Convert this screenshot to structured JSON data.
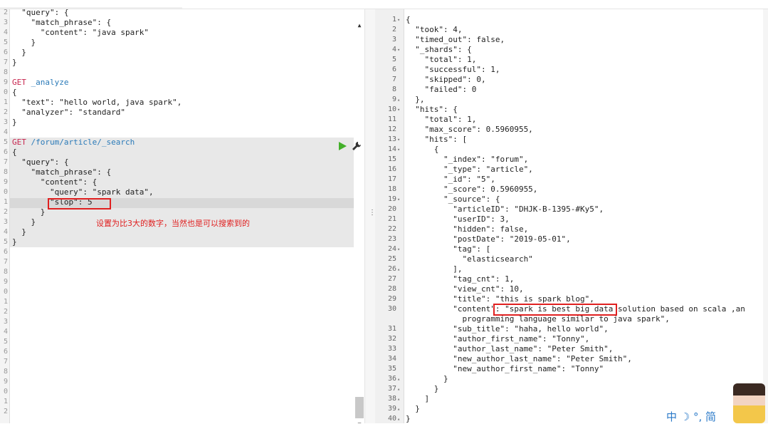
{
  "request": {
    "gutter_numbers": [
      "2",
      "3",
      "4",
      "5",
      "6",
      "7",
      "8",
      "9",
      "0",
      "1",
      "2",
      "3",
      "4",
      "5",
      "6",
      "7",
      "8",
      "9",
      "0",
      "1",
      "2",
      "3",
      "4",
      "5",
      "6",
      "7",
      "8",
      "9",
      "0",
      "1",
      "2",
      "3",
      "4",
      "5",
      "6",
      "7",
      "8",
      "9",
      "0",
      "1",
      "2"
    ],
    "lines": [
      {
        "indent": "  ",
        "text": "\"query\": {"
      },
      {
        "indent": "    ",
        "text": "\"match_phrase\": {"
      },
      {
        "indent": "      ",
        "text": "\"content\": \"java spark\""
      },
      {
        "indent": "    ",
        "text": "}"
      },
      {
        "indent": "  ",
        "text": "}"
      },
      {
        "indent": "",
        "text": "}"
      },
      {
        "indent": "",
        "text": ""
      },
      {
        "indent": "",
        "method": "GET",
        "url": "_analyze"
      },
      {
        "indent": "",
        "text": "{"
      },
      {
        "indent": "  ",
        "text": "\"text\": \"hello world, java spark\","
      },
      {
        "indent": "  ",
        "text": "\"analyzer\": \"standard\""
      },
      {
        "indent": "",
        "text": "}"
      },
      {
        "indent": "",
        "text": ""
      },
      {
        "indent": "",
        "method": "GET",
        "url": "/forum/article/_search"
      },
      {
        "indent": "",
        "text": "{"
      },
      {
        "indent": "  ",
        "text": "\"query\": {"
      },
      {
        "indent": "    ",
        "text": "\"match_phrase\": {"
      },
      {
        "indent": "      ",
        "text": "\"content\": {"
      },
      {
        "indent": "        ",
        "text": "\"query\": \"spark data\","
      },
      {
        "indent": "        ",
        "text": "\"slop\": 5"
      },
      {
        "indent": "      ",
        "text": "}"
      },
      {
        "indent": "    ",
        "text": "}"
      },
      {
        "indent": "  ",
        "text": "}"
      },
      {
        "indent": "",
        "text": "}"
      }
    ],
    "annotation": "设置为比3大的数字，当然也是可以搜索到的"
  },
  "response": {
    "lines": [
      {
        "n": "1",
        "fold": "▾",
        "text": "{"
      },
      {
        "n": "2",
        "text": "  \"took\": 4,"
      },
      {
        "n": "3",
        "text": "  \"timed_out\": false,"
      },
      {
        "n": "4",
        "fold": "▾",
        "text": "  \"_shards\": {"
      },
      {
        "n": "5",
        "text": "    \"total\": 1,"
      },
      {
        "n": "6",
        "text": "    \"successful\": 1,"
      },
      {
        "n": "7",
        "text": "    \"skipped\": 0,"
      },
      {
        "n": "8",
        "text": "    \"failed\": 0"
      },
      {
        "n": "9",
        "fold": "▴",
        "text": "  },"
      },
      {
        "n": "10",
        "fold": "▾",
        "text": "  \"hits\": {"
      },
      {
        "n": "11",
        "text": "    \"total\": 1,"
      },
      {
        "n": "12",
        "text": "    \"max_score\": 0.5960955,"
      },
      {
        "n": "13",
        "fold": "▾",
        "text": "    \"hits\": ["
      },
      {
        "n": "14",
        "fold": "▾",
        "text": "      {"
      },
      {
        "n": "15",
        "text": "        \"_index\": \"forum\","
      },
      {
        "n": "16",
        "text": "        \"_type\": \"article\","
      },
      {
        "n": "17",
        "text": "        \"_id\": \"5\","
      },
      {
        "n": "18",
        "text": "        \"_score\": 0.5960955,"
      },
      {
        "n": "19",
        "fold": "▾",
        "text": "        \"_source\": {"
      },
      {
        "n": "20",
        "text": "          \"articleID\": \"DHJK-B-1395-#Ky5\","
      },
      {
        "n": "21",
        "text": "          \"userID\": 3,"
      },
      {
        "n": "22",
        "text": "          \"hidden\": false,"
      },
      {
        "n": "23",
        "text": "          \"postDate\": \"2019-05-01\","
      },
      {
        "n": "24",
        "fold": "▾",
        "text": "          \"tag\": ["
      },
      {
        "n": "25",
        "text": "            \"elasticsearch\""
      },
      {
        "n": "26",
        "fold": "▴",
        "text": "          ],"
      },
      {
        "n": "27",
        "text": "          \"tag_cnt\": 1,"
      },
      {
        "n": "28",
        "text": "          \"view_cnt\": 10,"
      },
      {
        "n": "29",
        "text": "          \"title\": \"this is spark blog\","
      },
      {
        "n": "30",
        "text": "          \"content\": \"spark is best big data solution based on scala ,an"
      },
      {
        "n": "",
        "text": "            programming language similar to java spark\","
      },
      {
        "n": "31",
        "text": "          \"sub_title\": \"haha, hello world\","
      },
      {
        "n": "32",
        "text": "          \"author_first_name\": \"Tonny\","
      },
      {
        "n": "33",
        "text": "          \"author_last_name\": \"Peter Smith\","
      },
      {
        "n": "34",
        "text": "          \"new_author_last_name\": \"Peter Smith\","
      },
      {
        "n": "35",
        "text": "          \"new_author_first_name\": \"Tonny\""
      },
      {
        "n": "36",
        "fold": "▴",
        "text": "        }"
      },
      {
        "n": "37",
        "fold": "▴",
        "text": "      }"
      },
      {
        "n": "38",
        "fold": "▴",
        "text": "    ]"
      },
      {
        "n": "39",
        "fold": "▴",
        "text": "  }"
      },
      {
        "n": "40",
        "fold": "▴",
        "text": "}"
      }
    ]
  },
  "ime": {
    "label": "中 ☽ °, 简"
  },
  "icons": {
    "play": "play-icon",
    "wrench": "wrench-icon",
    "scroll_up": "▲",
    "scroll_down": "▼",
    "divider": "⋮"
  },
  "colors": {
    "method": "#c7254e",
    "url": "#2a7ab8",
    "run": "#43b02a",
    "highlight_box": "#e02020"
  }
}
